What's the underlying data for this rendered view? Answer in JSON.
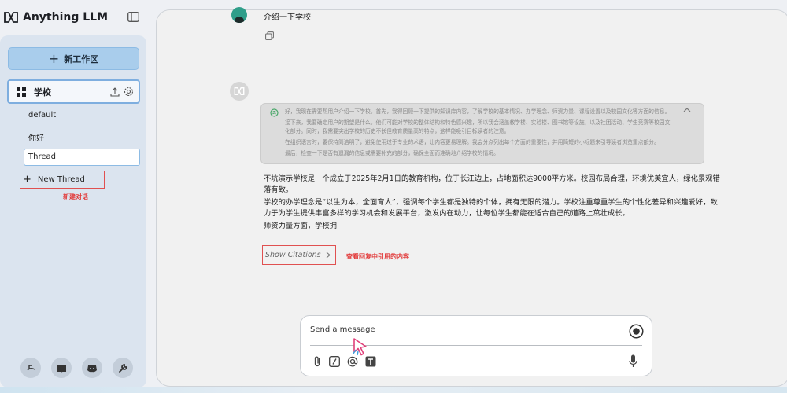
{
  "brand": {
    "name": "Anything LLM"
  },
  "sidebar": {
    "new_workspace_label": "新工作区",
    "workspace": {
      "name": "学校"
    },
    "threads": [
      {
        "label": "default"
      },
      {
        "label": "你好"
      },
      {
        "label": "Thread"
      }
    ],
    "new_thread_label": "New Thread",
    "new_thread_annotation": "新建对话",
    "footer_icons": [
      "community-hub-icon",
      "docs-book-icon",
      "discord-icon",
      "settings-wrench-icon"
    ]
  },
  "chat": {
    "user_message": "介绍一下学校",
    "thinking": [
      "好，我现在需要帮用户介绍一下学校。首先，我得回顾一下提供的知识库内容，了解学校的基本情况、办学理念、师资力量、课程设置以及校园文化等方面的信息。",
      "接下来，我要确定用户的期望是什么。他们可能对学校的整体结构和特色感兴趣，所以我会涵盖教学楼、实验楼、图书馆等设施，以及社团活动、学生竞赛等校园文化部分。同时，我需要突出学校的历史不长但教育质量高的特点，这样能吸引目标读者的注意。",
      "在组织语言时，要保持简洁明了，避免使用过于专业的术语，让内容更易理解。我会分点列出每个方面的重要性，并用简短的小标题来引导读者浏览重点部分。",
      "最后，检查一下是否有遗漏的信息或需要补充的部分，确保全面而准确地介绍学校的情况。"
    ],
    "answer": [
      "不坑演示学校是一个成立于2025年2月1日的教育机构，位于长江边上，占地面积达9000平方米。校园布局合理，环境优美宜人，绿化景观错落有致。",
      "学校的办学理念是“以生为本，全面育人”，强调每个学生都是独特的个体，拥有无限的潜力。学校注重尊重学生的个性化差异和兴趣爱好，致力于为学生提供丰富多样的学习机会和发展平台，激发内在动力，让每位学生都能在适合自己的道路上茁壮成长。",
      "师资力量方面，学校拥"
    ],
    "show_citations_label": "Show Citations",
    "citations_annotation": "查看回复中引用的内容"
  },
  "input": {
    "placeholder": "Send a message"
  }
}
